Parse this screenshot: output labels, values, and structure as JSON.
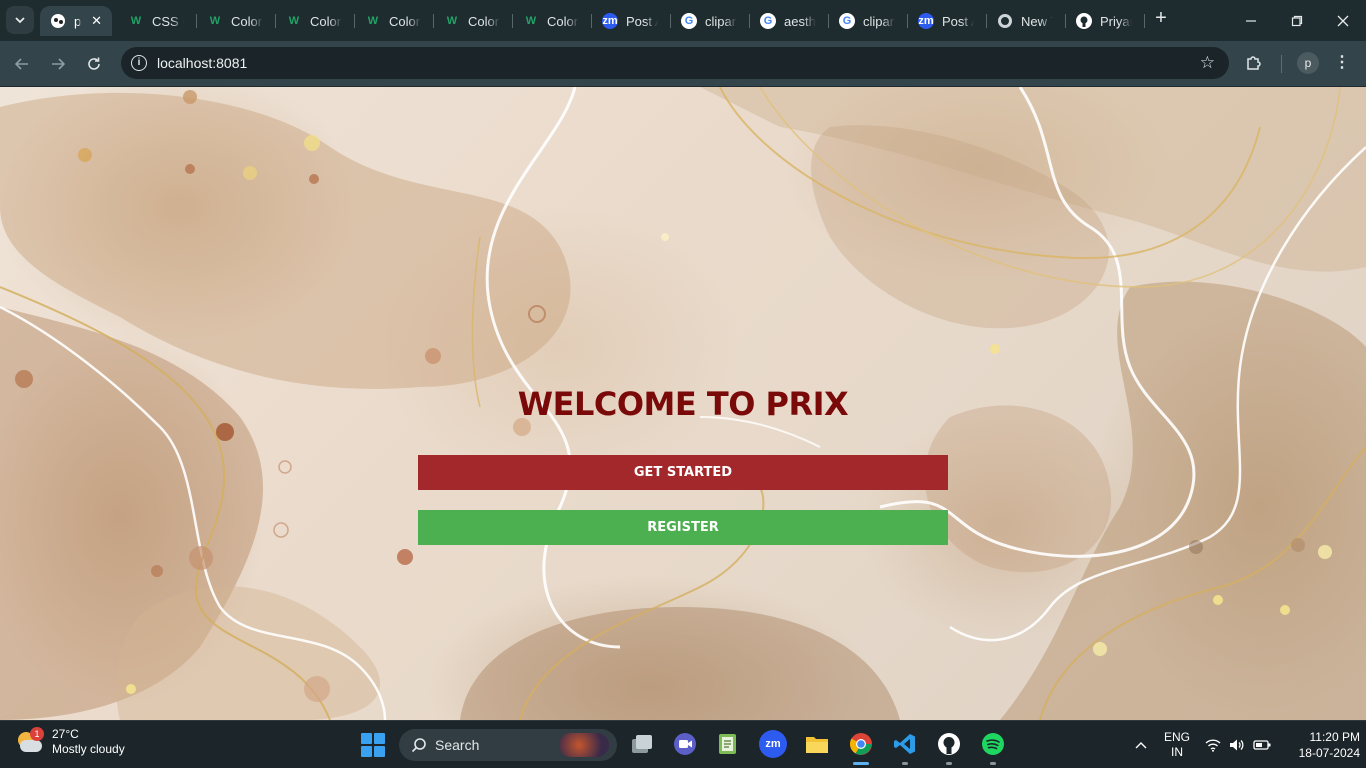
{
  "browser": {
    "tabs": [
      {
        "title": "pr",
        "favicon": "prix-favicon",
        "active": true
      },
      {
        "title": "CSS C",
        "favicon": "w3-icon"
      },
      {
        "title": "Color",
        "favicon": "w3-icon"
      },
      {
        "title": "Color",
        "favicon": "w3-icon"
      },
      {
        "title": "Color",
        "favicon": "w3-icon"
      },
      {
        "title": "Color",
        "favicon": "w3-icon"
      },
      {
        "title": "Color",
        "favicon": "w3-icon"
      },
      {
        "title": "Post A",
        "favicon": "zm-icon"
      },
      {
        "title": "clipart",
        "favicon": "google-icon"
      },
      {
        "title": "aesthe",
        "favicon": "google-icon"
      },
      {
        "title": "clipart",
        "favicon": "google-icon"
      },
      {
        "title": "Post A",
        "favicon": "zm-icon"
      },
      {
        "title": "New T",
        "favicon": "chrome-icon"
      },
      {
        "title": "Priyan",
        "favicon": "github-icon"
      }
    ],
    "url": "localhost:8081",
    "profile_initial": "p"
  },
  "page": {
    "heading": "WELCOME TO PRIX",
    "get_started_label": "GET STARTED",
    "register_label": "REGISTER",
    "colors": {
      "heading": "#7a0a0a",
      "get_started": "#a3282b",
      "register": "#4caf50"
    }
  },
  "taskbar": {
    "weather": {
      "badge": "1",
      "temp": "27°C",
      "condition": "Mostly cloudy"
    },
    "search_label": "Search",
    "apps": [
      "file-explorer-gallery",
      "meet",
      "notepad",
      "zoom",
      "files",
      "chrome",
      "vscode",
      "github-desktop",
      "spotify"
    ],
    "zoom_label": "zm",
    "lang": {
      "line1": "ENG",
      "line2": "IN"
    },
    "time": "11:20 PM",
    "date": "18-07-2024"
  }
}
